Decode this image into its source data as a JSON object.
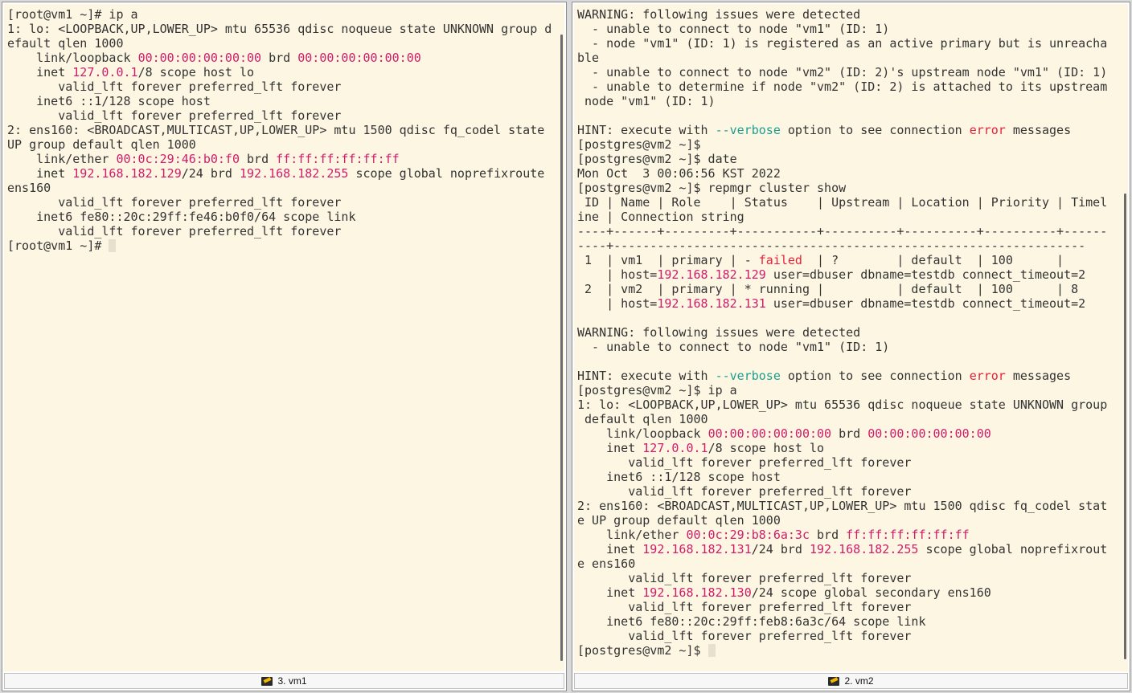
{
  "panes": {
    "left": {
      "tab_label": "3. vm1",
      "tab_icon": "terminal-icon",
      "prompt_final": "[root@vm1 ~]# "
    },
    "right": {
      "tab_label": "2. vm2",
      "tab_icon": "terminal-icon",
      "prompt_final": "[postgres@vm2 ~]$ "
    }
  },
  "colors": {
    "terminal_bg": "#fdf6e3",
    "text": "#333333",
    "highlight": "#d01c6a",
    "error": "#e8203a",
    "option": "#1a9e90"
  }
}
